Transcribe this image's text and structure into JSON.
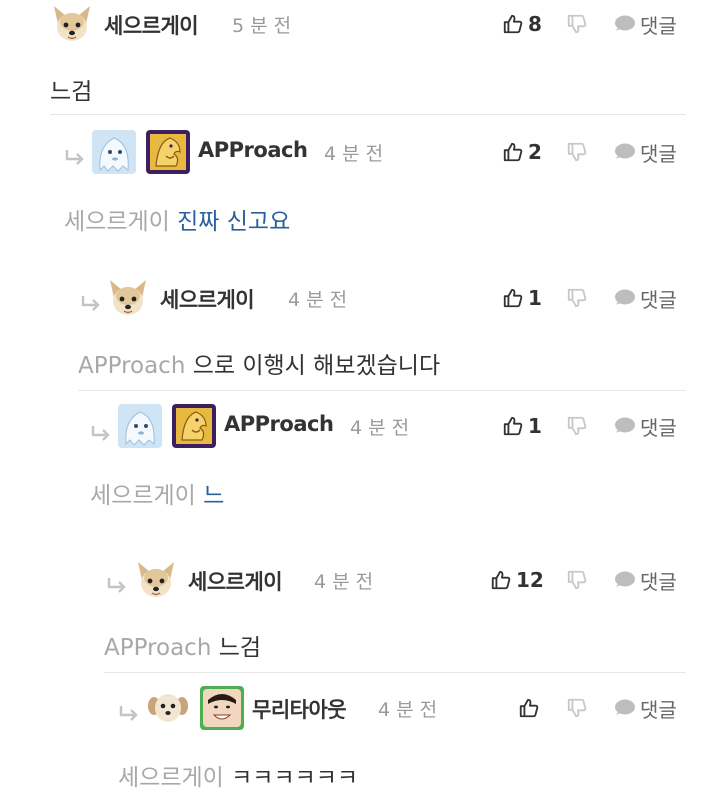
{
  "comments": [
    {
      "nickname": "세으르게이",
      "time": "5 분 전",
      "likes": "8",
      "reply_label": "댓글",
      "mention": "",
      "text": "느검",
      "avatars": [
        "dog-avatar"
      ]
    },
    {
      "nickname": "APProach",
      "time": "4 분 전",
      "likes": "2",
      "reply_label": "댓글",
      "mention": "세으르게이",
      "text": "진짜 신고요",
      "avatars": [
        "ghost-avatar",
        "lion-crest-avatar"
      ]
    },
    {
      "nickname": "세으르게이",
      "time": "4 분 전",
      "likes": "1",
      "reply_label": "댓글",
      "mention": "APProach",
      "text": "으로 이행시 해보겠습니다",
      "avatars": [
        "dog-avatar"
      ]
    },
    {
      "nickname": "APProach",
      "time": "4 분 전",
      "likes": "1",
      "reply_label": "댓글",
      "mention": "세으르게이",
      "text": "느",
      "avatars": [
        "ghost-avatar",
        "lion-crest-avatar"
      ]
    },
    {
      "nickname": "세으르게이",
      "time": "4 분 전",
      "likes": "12",
      "reply_label": "댓글",
      "mention": "APProach",
      "text": "느검",
      "avatars": [
        "dog-avatar"
      ]
    },
    {
      "nickname": "무리타아웃",
      "time": "4 분 전",
      "likes": "",
      "reply_label": "댓글",
      "mention": "세으르게이",
      "text": "ㅋㅋㅋㅋㅋㅋ",
      "avatars": [
        "puppy-avatar",
        "man-face-avatar"
      ]
    }
  ],
  "colors": {
    "mention": "#a8a8a8",
    "link": "#2b5f9e",
    "icon": "#333333",
    "muted_icon": "#c8c8c8"
  }
}
